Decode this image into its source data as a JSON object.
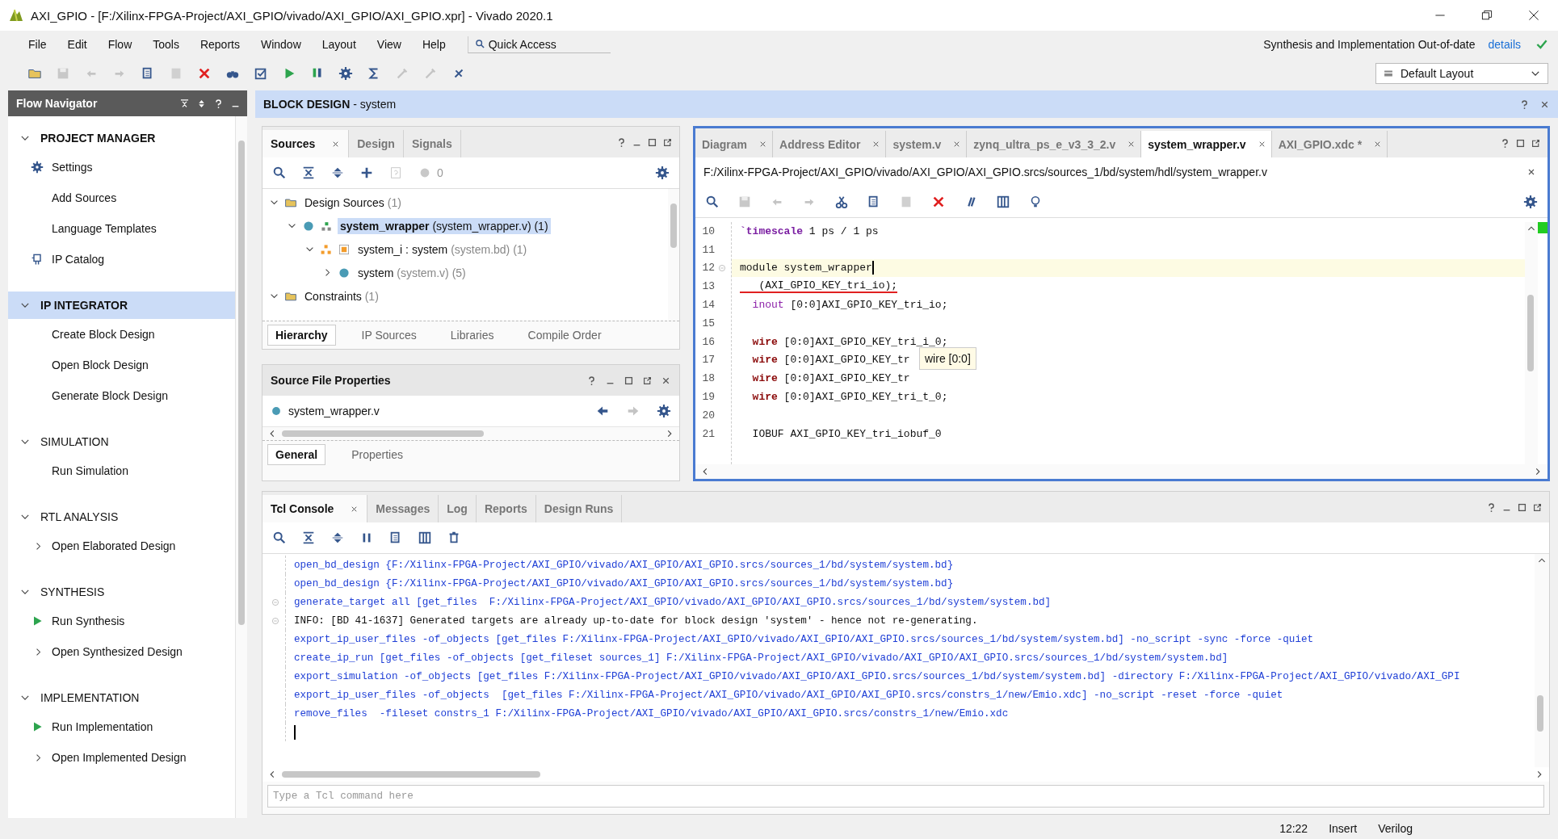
{
  "window": {
    "title": "AXI_GPIO - [F:/Xilinx-FPGA-Project/AXI_GPIO/vivado/AXI_GPIO/AXI_GPIO.xpr] - Vivado 2020.1"
  },
  "menu": [
    "File",
    "Edit",
    "Flow",
    "Tools",
    "Reports",
    "Window",
    "Layout",
    "View",
    "Help"
  ],
  "quick_access": "Quick Access",
  "status_message": "Synthesis and Implementation Out-of-date",
  "details_link": "details",
  "layout_select": "Default Layout",
  "flow_navigator": {
    "title": "Flow Navigator",
    "sections": [
      {
        "heading": "PROJECT MANAGER",
        "expanded": true,
        "selected": false,
        "bold": true,
        "items": [
          {
            "label": "Settings",
            "kind": "gear"
          },
          {
            "label": "Add Sources",
            "kind": "plain"
          },
          {
            "label": "Language Templates",
            "kind": "plain"
          },
          {
            "label": "IP Catalog",
            "kind": "ip"
          }
        ]
      },
      {
        "heading": "IP INTEGRATOR",
        "expanded": true,
        "selected": true,
        "bold": true,
        "items": [
          {
            "label": "Create Block Design",
            "kind": "plain"
          },
          {
            "label": "Open Block Design",
            "kind": "plain"
          },
          {
            "label": "Generate Block Design",
            "kind": "plain"
          }
        ]
      },
      {
        "heading": "SIMULATION",
        "expanded": true,
        "selected": false,
        "bold": false,
        "items": [
          {
            "label": "Run Simulation",
            "kind": "plain"
          }
        ]
      },
      {
        "heading": "RTL ANALYSIS",
        "expanded": true,
        "selected": false,
        "bold": false,
        "items": [
          {
            "label": "Open Elaborated Design",
            "kind": "expandable"
          }
        ]
      },
      {
        "heading": "SYNTHESIS",
        "expanded": true,
        "selected": false,
        "bold": false,
        "items": [
          {
            "label": "Run Synthesis",
            "kind": "run"
          },
          {
            "label": "Open Synthesized Design",
            "kind": "expandable"
          }
        ]
      },
      {
        "heading": "IMPLEMENTATION",
        "expanded": true,
        "selected": false,
        "bold": false,
        "items": [
          {
            "label": "Run Implementation",
            "kind": "run"
          },
          {
            "label": "Open Implemented Design",
            "kind": "expandable"
          }
        ]
      }
    ]
  },
  "block_design": {
    "title": "**BLOCK DESIGN** - system"
  },
  "sources": {
    "tabs": [
      {
        "label": "Sources",
        "selected": true
      },
      {
        "label": "Design",
        "selected": false
      },
      {
        "label": "Signals",
        "selected": false
      }
    ],
    "count": "0",
    "tree": [
      {
        "name": "Design Sources",
        "detail": "(1)",
        "kind": "folder",
        "expanded": true,
        "selected": false,
        "children": [
          {
            "name": "system_wrapper",
            "detail": "(system_wrapper.v) (1)",
            "kind": "top",
            "expanded": true,
            "selected": true,
            "children": [
              {
                "name": "system_i : system",
                "detail": "(system.bd) (1)",
                "kind": "bd",
                "expanded": true,
                "selected": false,
                "children": [
                  {
                    "name": "system",
                    "detail": "(system.v) (5)",
                    "kind": "module",
                    "expanded": false,
                    "selected": false
                  }
                ]
              }
            ]
          }
        ]
      },
      {
        "name": "Constraints",
        "detail": "(1)",
        "kind": "folder",
        "expanded": true,
        "selected": false
      }
    ],
    "bottom_tabs": [
      {
        "label": "Hierarchy",
        "selected": true
      },
      {
        "label": "IP Sources",
        "selected": false
      },
      {
        "label": "Libraries",
        "selected": false
      },
      {
        "label": "Compile Order",
        "selected": false
      }
    ]
  },
  "properties": {
    "title": "Source File Properties",
    "file": "system_wrapper.v",
    "tabs": [
      {
        "label": "General",
        "selected": true
      },
      {
        "label": "Properties",
        "selected": false
      }
    ]
  },
  "editor": {
    "tabs": [
      {
        "label": "Diagram",
        "selected": false
      },
      {
        "label": "Address Editor",
        "selected": false
      },
      {
        "label": "system.v",
        "selected": false
      },
      {
        "label": "zynq_ultra_ps_e_v3_3_2.v",
        "selected": false
      },
      {
        "label": "system_wrapper.v",
        "selected": true
      },
      {
        "label": "AXI_GPIO.xdc *",
        "selected": false
      }
    ],
    "path": "F:/Xilinx-FPGA-Project/AXI_GPIO/vivado/AXI_GPIO/AXI_GPIO.srcs/sources_1/bd/system/hdl/system_wrapper.v",
    "lines": [
      {
        "number": "10",
        "segments": [
          {
            "kind": "directive",
            "text": "`timescale"
          },
          {
            "kind": "plain",
            "text": " 1 ps / 1 ps"
          }
        ]
      },
      {
        "number": "11"
      },
      {
        "number": "12",
        "fold": true,
        "current": true,
        "segments": [
          {
            "kind": "plain",
            "text": "module system_wrapper"
          }
        ]
      },
      {
        "number": "13",
        "underlined": true,
        "segments": [
          {
            "kind": "plain",
            "text": "   (AXI_GPIO_KEY_tri_io);"
          }
        ]
      },
      {
        "number": "14",
        "segments": [
          {
            "kind": "port",
            "text": "  inout"
          },
          {
            "kind": "plain",
            "text": " [0:0]AXI_GPIO_KEY_tri_io;"
          }
        ]
      },
      {
        "number": "15"
      },
      {
        "number": "16",
        "segments": [
          {
            "kind": "keyword",
            "text": "  wire"
          },
          {
            "kind": "plain",
            "text": " [0:0]AXI_GPIO_KEY_tri_i_0;"
          }
        ]
      },
      {
        "number": "17",
        "segments": [
          {
            "kind": "keyword",
            "text": "  wire"
          },
          {
            "kind": "plain",
            "text": " [0:0]AXI_GPIO_KEY_tr"
          }
        ]
      },
      {
        "number": "18",
        "segments": [
          {
            "kind": "keyword",
            "text": "  wire"
          },
          {
            "kind": "plain",
            "text": " [0:0]AXI_GPIO_KEY_tr"
          }
        ]
      },
      {
        "number": "19",
        "segments": [
          {
            "kind": "keyword",
            "text": "  wire"
          },
          {
            "kind": "plain",
            "text": " [0:0]AXI_GPIO_KEY_tri_t_0;"
          }
        ]
      },
      {
        "number": "20"
      },
      {
        "number": "21",
        "segments": [
          {
            "kind": "plain",
            "text": "  IOBUF AXI_GPIO_KEY_tri_iobuf_0"
          }
        ]
      }
    ],
    "tooltip": "wire [0:0]"
  },
  "console": {
    "tabs": [
      {
        "label": "Tcl Console",
        "selected": true
      },
      {
        "label": "Messages",
        "selected": false
      },
      {
        "label": "Log",
        "selected": false
      },
      {
        "label": "Reports",
        "selected": false
      },
      {
        "label": "Design Runs",
        "selected": false
      }
    ],
    "lines": [
      {
        "kind": "command",
        "text": "open_bd_design {F:/Xilinx-FPGA-Project/AXI_GPIO/vivado/AXI_GPIO/AXI_GPIO.srcs/sources_1/bd/system/system.bd}"
      },
      {
        "kind": "command",
        "text": "open_bd_design {F:/Xilinx-FPGA-Project/AXI_GPIO/vivado/AXI_GPIO/AXI_GPIO.srcs/sources_1/bd/system/system.bd}"
      },
      {
        "kind": "command",
        "fold": true,
        "text": "generate_target all [get_files  F:/Xilinx-FPGA-Project/AXI_GPIO/vivado/AXI_GPIO/AXI_GPIO.srcs/sources_1/bd/system/system.bd]"
      },
      {
        "kind": "info",
        "fold": true,
        "text": "INFO: [BD 41-1637] Generated targets are already up-to-date for block design 'system' - hence not re-generating."
      },
      {
        "kind": "command",
        "text": "export_ip_user_files -of_objects [get_files F:/Xilinx-FPGA-Project/AXI_GPIO/vivado/AXI_GPIO/AXI_GPIO.srcs/sources_1/bd/system/system.bd] -no_script -sync -force -quiet"
      },
      {
        "kind": "command",
        "text": "create_ip_run [get_files -of_objects [get_fileset sources_1] F:/Xilinx-FPGA-Project/AXI_GPIO/vivado/AXI_GPIO/AXI_GPIO.srcs/sources_1/bd/system/system.bd]"
      },
      {
        "kind": "command",
        "text": "export_simulation -of_objects [get_files F:/Xilinx-FPGA-Project/AXI_GPIO/vivado/AXI_GPIO/AXI_GPIO.srcs/sources_1/bd/system/system.bd] -directory F:/Xilinx-FPGA-Project/AXI_GPIO/vivado/AXI_GPI"
      },
      {
        "kind": "command",
        "text": "export_ip_user_files -of_objects  [get_files F:/Xilinx-FPGA-Project/AXI_GPIO/vivado/AXI_GPIO/AXI_GPIO.srcs/constrs_1/new/Emio.xdc] -no_script -reset -force -quiet"
      },
      {
        "kind": "command",
        "text": "remove_files  -fileset constrs_1 F:/Xilinx-FPGA-Project/AXI_GPIO/vivado/AXI_GPIO/AXI_GPIO.srcs/constrs_1/new/Emio.xdc"
      }
    ],
    "input": {
      "placeholder": "Type a Tcl command here"
    }
  },
  "status_bar": [
    "12:22",
    "Insert",
    "Verilog"
  ]
}
